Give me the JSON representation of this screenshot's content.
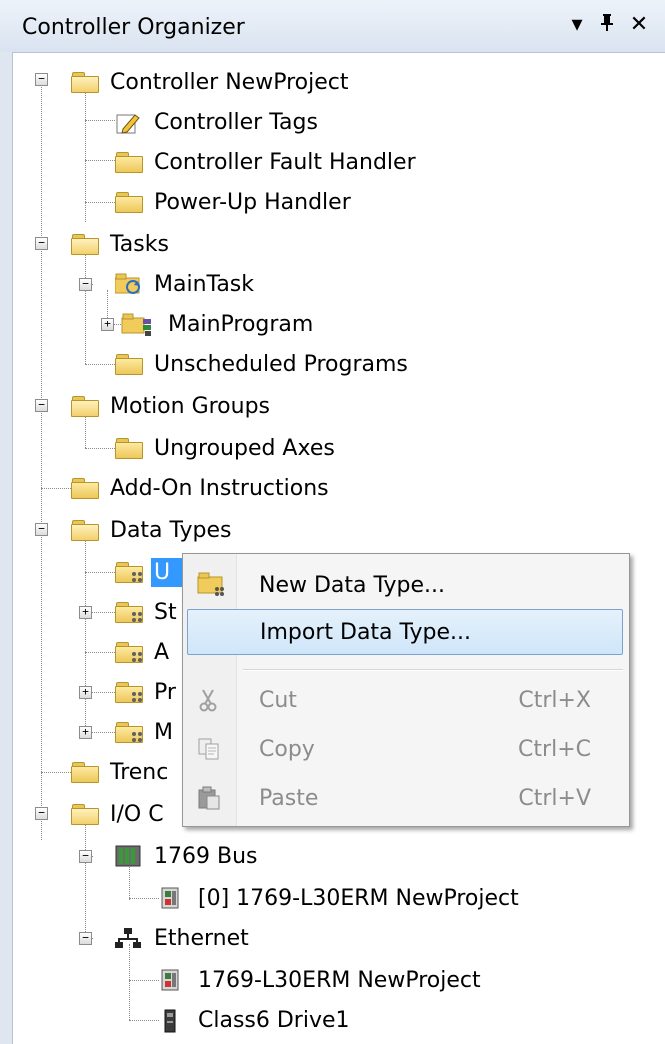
{
  "window": {
    "title": "Controller Organizer",
    "dropdown_glyph": "▾",
    "pin_glyph": "ᴘ",
    "close_glyph": "✕"
  },
  "tree": {
    "controller": "Controller NewProject",
    "controller_tags": "Controller Tags",
    "fault_handler": "Controller Fault Handler",
    "powerup_handler": "Power-Up Handler",
    "tasks": "Tasks",
    "main_task": "MainTask",
    "main_program": "MainProgram",
    "unscheduled": "Unscheduled Programs",
    "motion_groups": "Motion Groups",
    "ungrouped_axes": "Ungrouped Axes",
    "aoi": "Add-On Instructions",
    "data_types": "Data Types",
    "user_defined_visible": "U",
    "strings_visible": "St",
    "addon_defined_visible": "A",
    "predefined_visible": "Pr",
    "module_defined_visible": "M",
    "trends_visible": "Trenc",
    "io_config_visible": "I/O C",
    "bus_1769": "1769 Bus",
    "l30erm_slot": "[0] 1769-L30ERM NewProject",
    "ethernet": "Ethernet",
    "l30erm": "1769-L30ERM NewProject",
    "drive": "Class6 Drive1"
  },
  "context_menu": {
    "new_data_type": "New Data Type...",
    "import_data_type": "Import Data Type...",
    "cut": "Cut",
    "cut_key": "Ctrl+X",
    "copy": "Copy",
    "copy_key": "Ctrl+C",
    "paste": "Paste",
    "paste_key": "Ctrl+V"
  },
  "expander": {
    "expanded": "−",
    "collapsed": "+"
  },
  "colors": {
    "selection": "#3399ff",
    "menu_highlight": "#cfe6fa",
    "folder": "#eec85a"
  },
  "icons": {
    "folder": "folder-icon",
    "folder_open": "folder-open-icon",
    "tags": "tag-pencil-icon",
    "task": "task-icon",
    "program": "program-icon",
    "udt": "data-type-icon",
    "rack": "rack-icon",
    "module": "module-icon",
    "network": "network-icon",
    "drive": "drive-icon",
    "cut": "scissors-icon",
    "copy": "copy-icon",
    "paste": "paste-icon"
  }
}
